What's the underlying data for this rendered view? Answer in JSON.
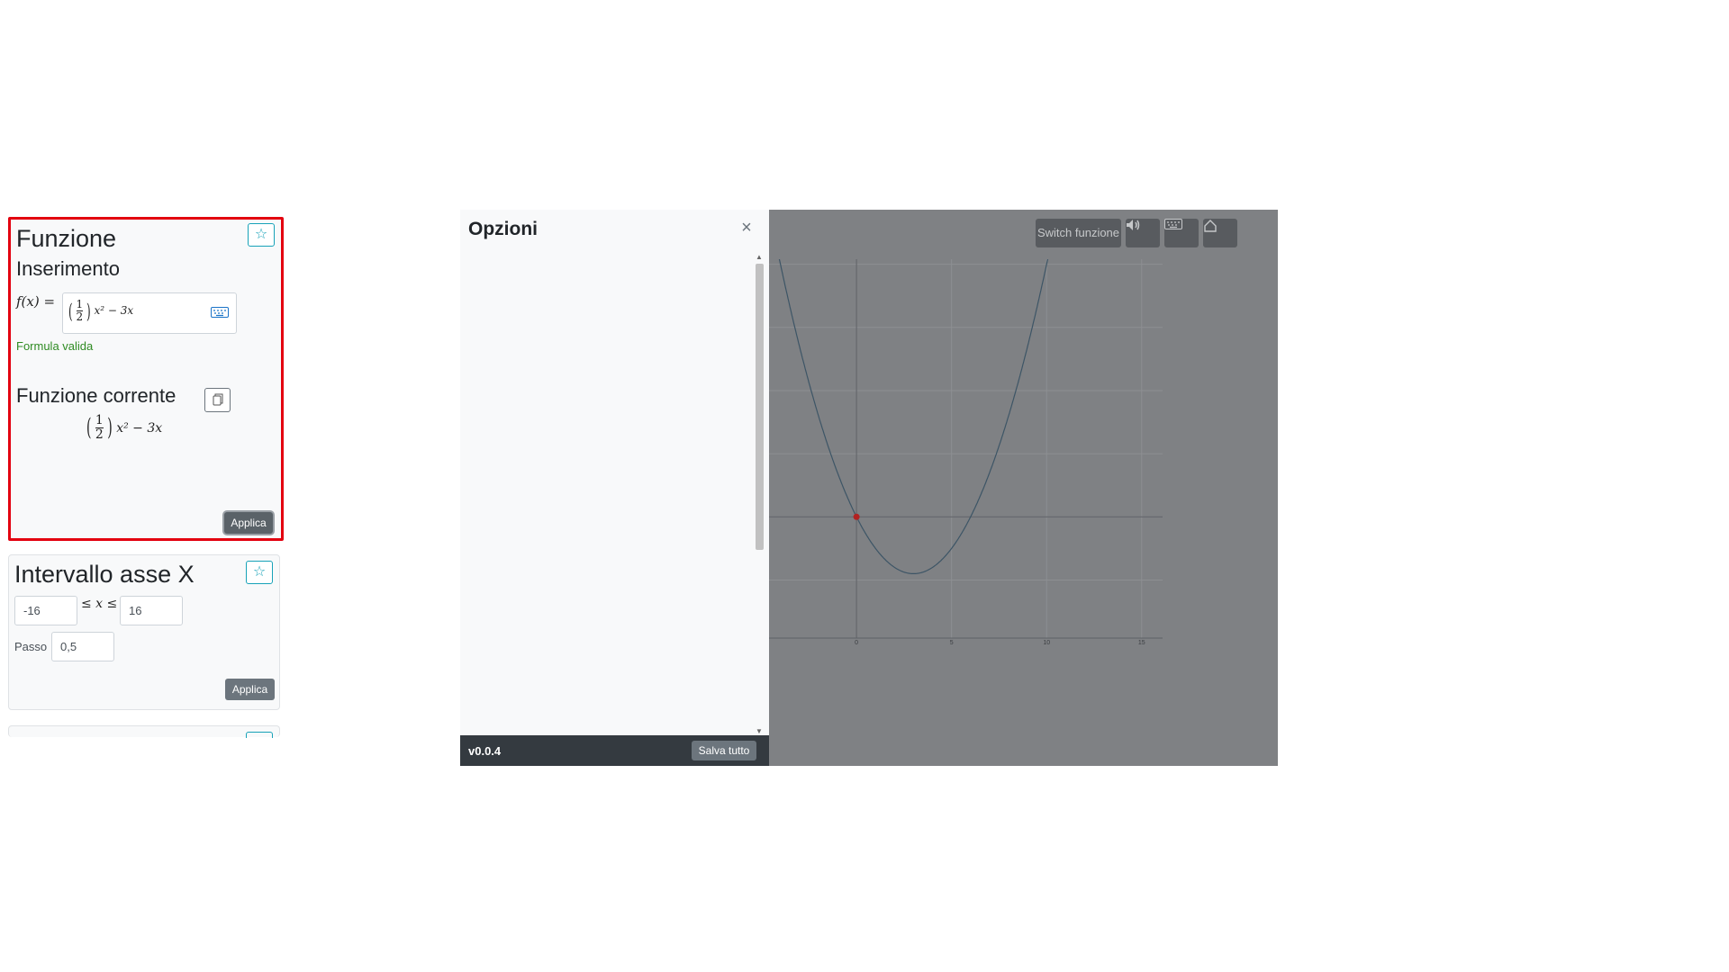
{
  "panel": {
    "title": "Opzioni",
    "close_label": "×"
  },
  "funzione_card": {
    "title": "Funzione",
    "subtitle": "Inserimento",
    "fx_label": "f(x) =",
    "formula_input": {
      "frac_num": "1",
      "frac_den": "2",
      "paren_left": "(",
      "paren_right": ")",
      "tail": "x² − 3x"
    },
    "validity": "Formula valida",
    "validity_color": "#2e8b22",
    "current_title": "Funzione corrente",
    "current_formula": {
      "frac_num": "1",
      "frac_den": "2",
      "paren_left": "(",
      "paren_right": ")",
      "tail": "x² − 3x"
    },
    "apply_label": "Applica",
    "highlight_color": "#e3000f"
  },
  "asse_card": {
    "title": "Intervallo asse X",
    "min_value": "-16",
    "max_value": "16",
    "inequality": "≤ x ≤",
    "step_label": "Passo",
    "step_value": "0,5",
    "apply_label": "Applica"
  },
  "footer": {
    "version": "v0.0.4",
    "save_all_label": "Salva tutto"
  },
  "toolbar": {
    "switch_label": "Switch funzione",
    "icons": [
      "volume-icon",
      "keyboard-icon",
      "home-icon"
    ]
  },
  "icons": {
    "star": "star-icon",
    "keyboard": "keyboard-icon",
    "copy": "copy-icon",
    "scroll_up": "▲",
    "scroll_down": "▼"
  },
  "chart_data": {
    "type": "line",
    "function": "(1/2)x^2 - 3x",
    "x_ticks": [
      "0",
      "5",
      "10",
      "15"
    ],
    "xlim": [
      -4.6,
      16.1
    ],
    "ylim": [
      -9.6,
      20.4
    ],
    "grid": true,
    "highlight_point": {
      "x": 0,
      "y": 0,
      "color": "#b22222"
    },
    "line_color": "#3d5566",
    "background": "#7f8184"
  }
}
